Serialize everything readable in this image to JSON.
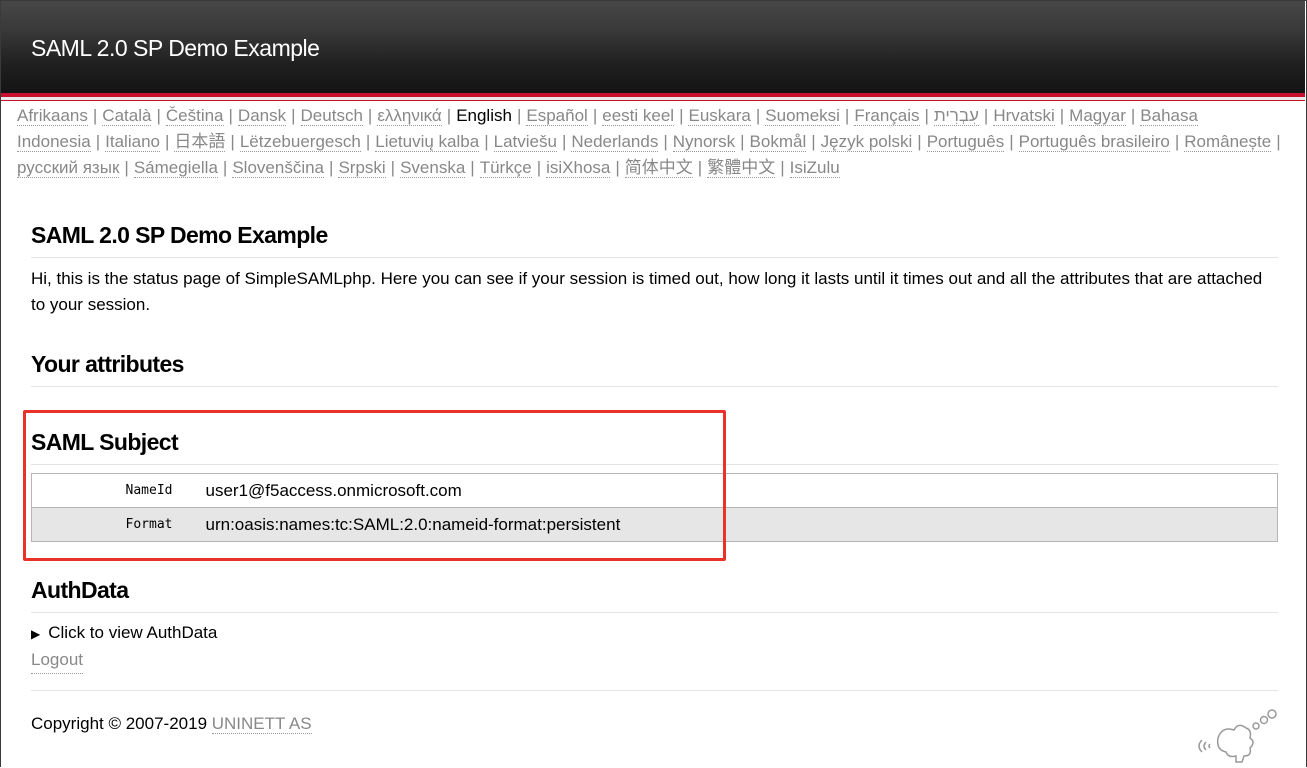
{
  "header": {
    "title": "SAML 2.0 SP Demo Example"
  },
  "languages": [
    {
      "label": "Afrikaans",
      "selected": false
    },
    {
      "label": "Català",
      "selected": false
    },
    {
      "label": "Čeština",
      "selected": false
    },
    {
      "label": "Dansk",
      "selected": false
    },
    {
      "label": "Deutsch",
      "selected": false
    },
    {
      "label": "ελληνικά",
      "selected": false
    },
    {
      "label": "English",
      "selected": true
    },
    {
      "label": "Español",
      "selected": false
    },
    {
      "label": "eesti keel",
      "selected": false
    },
    {
      "label": "Euskara",
      "selected": false
    },
    {
      "label": "Suomeksi",
      "selected": false
    },
    {
      "label": "Français",
      "selected": false
    },
    {
      "label": "עִבְרִית",
      "selected": false
    },
    {
      "label": "Hrvatski",
      "selected": false
    },
    {
      "label": "Magyar",
      "selected": false
    },
    {
      "label": "Bahasa Indonesia",
      "selected": false
    },
    {
      "label": "Italiano",
      "selected": false
    },
    {
      "label": "日本語",
      "selected": false
    },
    {
      "label": "Lëtzebuergesch",
      "selected": false
    },
    {
      "label": "Lietuvių kalba",
      "selected": false
    },
    {
      "label": "Latviešu",
      "selected": false
    },
    {
      "label": "Nederlands",
      "selected": false
    },
    {
      "label": "Nynorsk",
      "selected": false
    },
    {
      "label": "Bokmål",
      "selected": false
    },
    {
      "label": "Język polski",
      "selected": false
    },
    {
      "label": "Português",
      "selected": false
    },
    {
      "label": "Português brasileiro",
      "selected": false
    },
    {
      "label": "Românește",
      "selected": false
    },
    {
      "label": "русский язык",
      "selected": false
    },
    {
      "label": "Sámegiella",
      "selected": false
    },
    {
      "label": "Slovenščina",
      "selected": false
    },
    {
      "label": "Srpski",
      "selected": false
    },
    {
      "label": "Svenska",
      "selected": false
    },
    {
      "label": "Türkçe",
      "selected": false
    },
    {
      "label": "isiXhosa",
      "selected": false
    },
    {
      "label": "简体中文",
      "selected": false
    },
    {
      "label": "繁體中文",
      "selected": false
    },
    {
      "label": "IsiZulu",
      "selected": false
    }
  ],
  "main": {
    "heading": "SAML 2.0 SP Demo Example",
    "intro": "Hi, this is the status page of SimpleSAMLphp. Here you can see if your session is timed out, how long it lasts until it times out and all the attributes that are attached to your session.",
    "attributes_heading": "Your attributes",
    "subject_heading": "SAML Subject",
    "subject_rows": [
      {
        "key": "NameId",
        "value": "user1@f5access.onmicrosoft.com"
      },
      {
        "key": "Format",
        "value": "urn:oasis:names:tc:SAML:2.0:nameid-format:persistent"
      }
    ],
    "authdata_heading": "AuthData",
    "authdata_toggle": "Click to view AuthData",
    "logout_label": "Logout"
  },
  "footer": {
    "copyright": "Copyright © 2007-2019 ",
    "org_link": "UNINETT AS"
  },
  "colors": {
    "accent": "#c8102e",
    "highlight": "#e8332a",
    "header_bg": "#2b2b2b"
  }
}
